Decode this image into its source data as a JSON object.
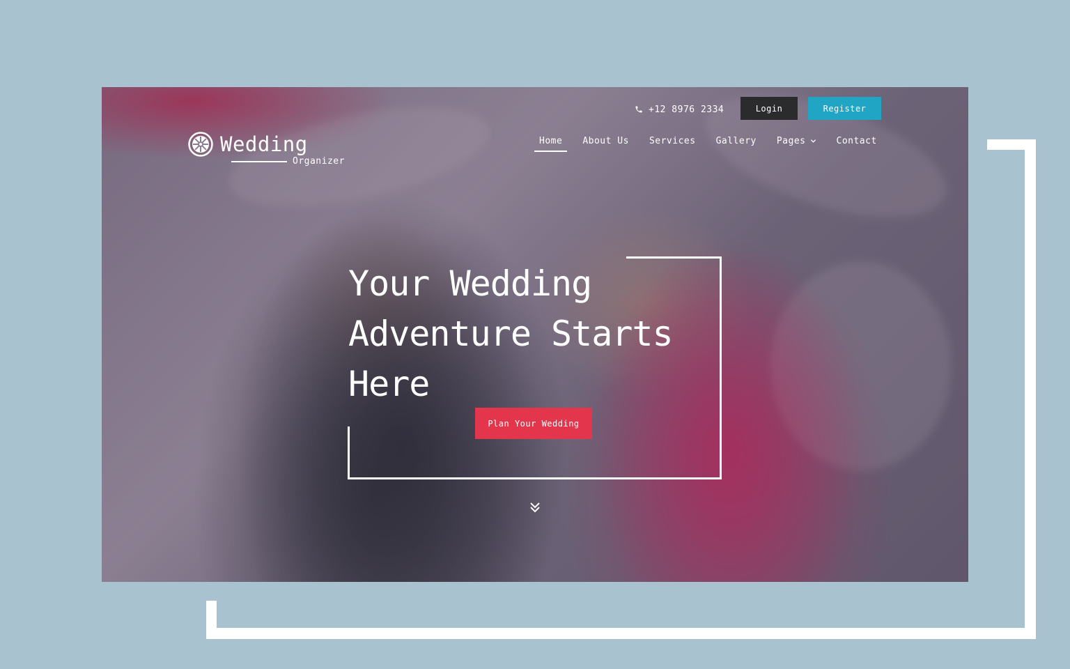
{
  "topbar": {
    "phone": "+12 8976 2334",
    "login_label": "Login",
    "register_label": "Register"
  },
  "logo": {
    "title": "Wedding",
    "subtitle": "Organizer"
  },
  "nav": {
    "items": [
      {
        "label": "Home",
        "active": true
      },
      {
        "label": "About Us"
      },
      {
        "label": "Services"
      },
      {
        "label": "Gallery"
      },
      {
        "label": "Pages",
        "has_dropdown": true
      },
      {
        "label": "Contact"
      }
    ]
  },
  "hero": {
    "headline": "Your Wedding Adventure Starts Here",
    "cta_label": "Plan Your Wedding"
  },
  "icons": {
    "phone": "phone-icon",
    "logo": "wheel-logo-icon",
    "dropdown": "chevron-down-icon",
    "scroll": "double-chevron-down-icon"
  },
  "colors": {
    "page_background": "#a9c2cf",
    "login_button": "#2b2b2e",
    "register_button": "#20a5c4",
    "cta_button": "#e3354b",
    "text": "#ffffff"
  }
}
